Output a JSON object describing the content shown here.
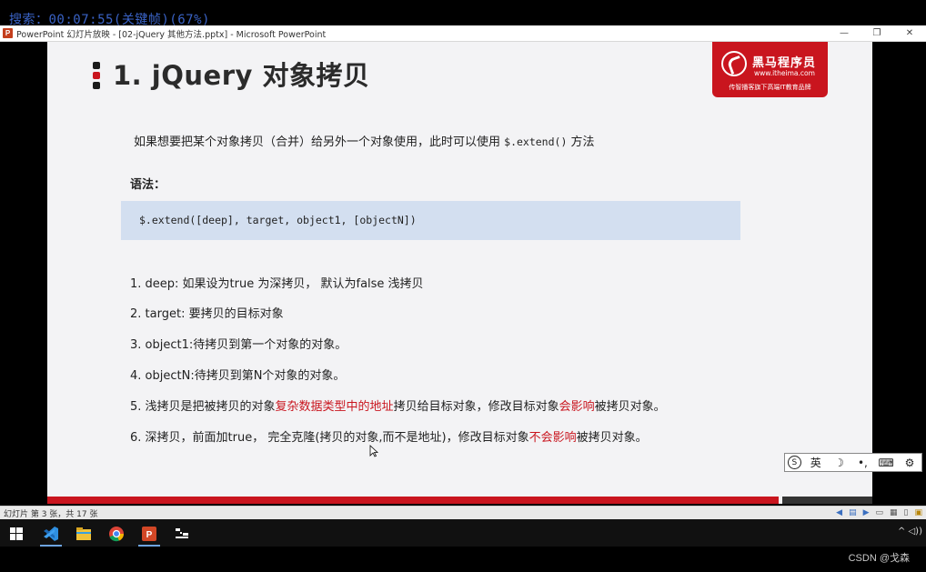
{
  "overlay": {
    "search_text": "搜索：00:07:55(关键帧)(67%)"
  },
  "window": {
    "title": "PowerPoint 幻灯片放映 - [02-jQuery 其他方法.pptx] - Microsoft PowerPoint",
    "app_icon_letter": "P",
    "minimize": "—",
    "restore": "❐",
    "close": "✕"
  },
  "slide": {
    "title": "1. jQuery 对象拷贝",
    "logo": {
      "name": "黑马程序员",
      "url": "www.itheima.com",
      "slogan": "传智播客旗下高端IT教育品牌"
    },
    "intro_prefix": "如果想要把某个对象拷贝（合并）给另外一个对象使用，此时可以使用 ",
    "intro_code": "$.extend()",
    "intro_suffix": " 方法",
    "syntax_label": "语法：",
    "syntax_code": "$.extend([deep], target, object1, [objectN])",
    "items": [
      {
        "text": "1. deep: 如果设为true 为深拷贝， 默认为false  浅拷贝"
      },
      {
        "text": "2. target: 要拷贝的目标对象"
      },
      {
        "text": "3. object1:待拷贝到第一个对象的对象。"
      },
      {
        "text": "4. objectN:待拷贝到第N个对象的对象。"
      },
      {
        "pre": "5. 浅拷贝是把被拷贝的对象",
        "hl": "复杂数据类型中的地址",
        "post": "拷贝给目标对象，修改目标对象",
        "hl2": "会影响",
        "post2": "被拷贝对象。"
      },
      {
        "pre": "6. 深拷贝，前面加true， 完全克隆(拷贝的对象,而不是地址)，修改目标对象",
        "hl": "不会影响",
        "post": "被拷贝对象。"
      }
    ],
    "colors": {
      "accent_red": "#c9151e",
      "code_bg": "#d3dff0"
    }
  },
  "ime": {
    "logo": "S",
    "lang": "英",
    "moon": "☽",
    "punct": "•,",
    "keyboard": "⌨",
    "settings": "⚙"
  },
  "statusbar": {
    "slide_info": "幻灯片 第 3 张，共 17 张"
  },
  "taskbar": {
    "items": [
      "windows-start",
      "visual-studio-code",
      "file-explorer",
      "chrome",
      "powerpoint",
      "tool"
    ],
    "tray": "^ ◁))"
  },
  "watermark": "CSDN @戈森"
}
